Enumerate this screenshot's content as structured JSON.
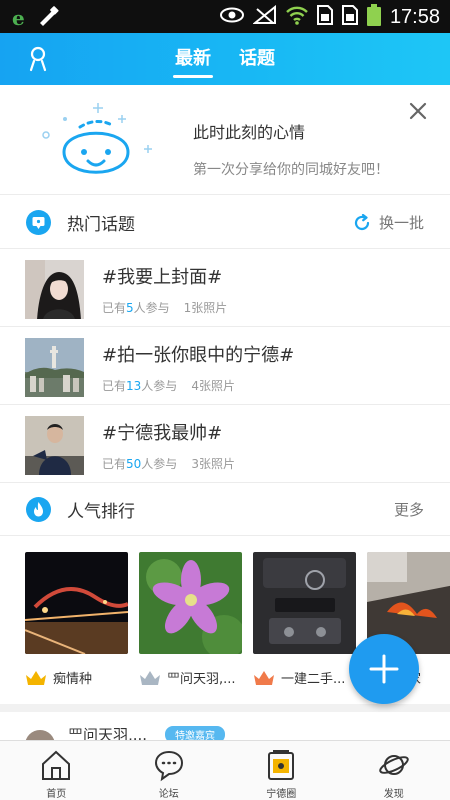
{
  "status_bar": {
    "time": "17:58"
  },
  "top_tabs": {
    "items": [
      "最新",
      "话题"
    ],
    "active": 0
  },
  "mood": {
    "title": "此时此刻的心情",
    "subtitle": "第一次分享给你的同城好友吧！"
  },
  "hot_topics": {
    "header": "热门话题",
    "refresh": "换一批",
    "items": [
      {
        "title": "#我要上封面#",
        "joined_prefix": "已有",
        "count": "5",
        "joined_suffix": "人参与",
        "photos": "1张照片"
      },
      {
        "title": "#拍一张你眼中的宁德#",
        "joined_prefix": "已有",
        "count": "13",
        "joined_suffix": "人参与",
        "photos": "4张照片"
      },
      {
        "title": "#宁德我最帅#",
        "joined_prefix": "已有",
        "count": "50",
        "joined_suffix": "人参与",
        "photos": "3张照片"
      }
    ]
  },
  "popularity": {
    "header": "人气排行",
    "more": "更多",
    "items": [
      {
        "name": "痴情种",
        "crown": "#f4b400"
      },
      {
        "name": "罒问天羽,...",
        "crown": "#a9b6c3"
      },
      {
        "name": "一建二手...",
        "crown": "#f07a4a"
      },
      {
        "name": "赢家",
        "crown": "#f4b400"
      }
    ]
  },
  "feed_peek": {
    "name": "罒问天羽,...",
    "badge": "特邀嘉宾"
  },
  "bottom_nav": [
    {
      "label": "首页",
      "icon": "house-icon"
    },
    {
      "label": "论坛",
      "icon": "chat-bubbles-icon"
    },
    {
      "label": "宁德圈",
      "icon": "ningde-circle-icon"
    },
    {
      "label": "发现",
      "icon": "planet-icon"
    }
  ],
  "colors": {
    "accent": "#1aa6f0",
    "header_gradient_start": "#16a3f2",
    "header_gradient_end": "#1ec6f6",
    "fab": "#1f9bf0"
  }
}
